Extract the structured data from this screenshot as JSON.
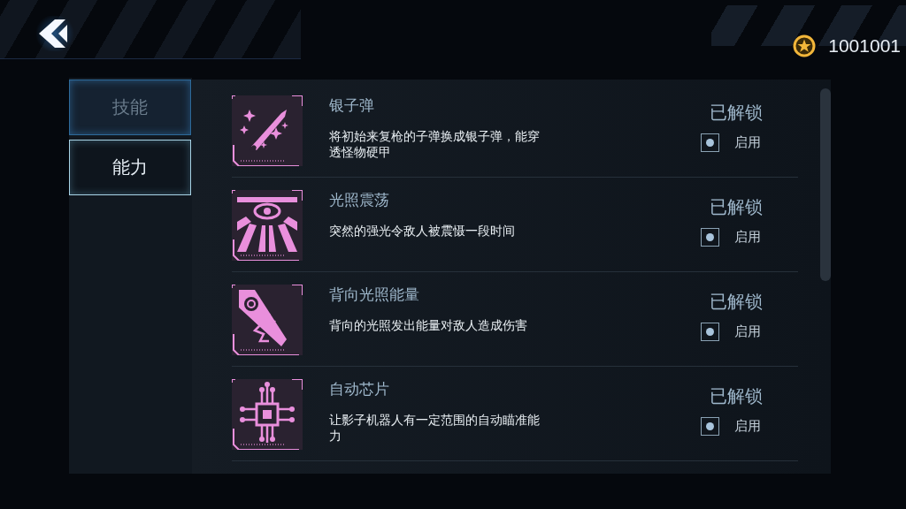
{
  "header": {
    "coins": "1001001"
  },
  "tabs": [
    {
      "label": "技能",
      "selected": false
    },
    {
      "label": "能力",
      "selected": true
    }
  ],
  "abilities": [
    {
      "kind": "bullet",
      "title": "银子弹",
      "description": "将初始来复枪的子弹换成银子弹，能穿透怪物硬甲",
      "status": "已解锁",
      "toggle_label": "启用",
      "enabled": true
    },
    {
      "kind": "eye",
      "title": "光照震荡",
      "description": "突然的强光令敌人被震慑一段时间",
      "status": "已解锁",
      "toggle_label": "启用",
      "enabled": true
    },
    {
      "kind": "beam",
      "title": "背向光照能量",
      "description": "背向的光照发出能量对敌人造成伤害",
      "status": "已解锁",
      "toggle_label": "启用",
      "enabled": true
    },
    {
      "kind": "chip",
      "title": "自动芯片",
      "description": "让影子机器人有一定范围的自动瞄准能力",
      "status": "已解锁",
      "toggle_label": "启用",
      "enabled": true
    }
  ]
}
